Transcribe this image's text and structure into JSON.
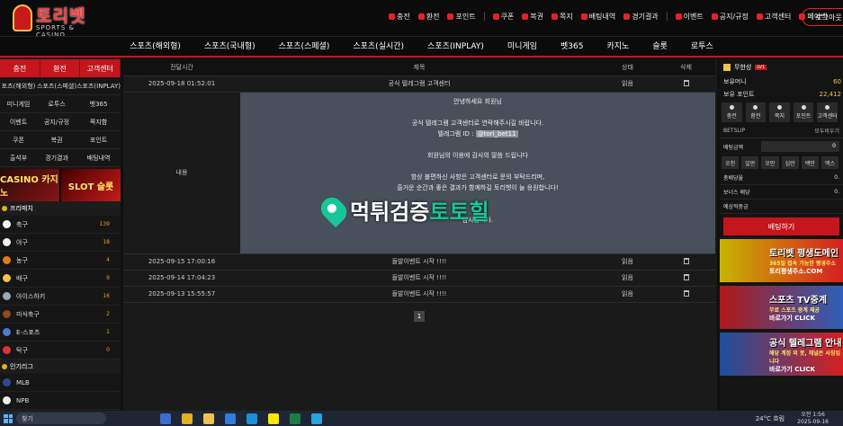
{
  "site": {
    "logo_text": "토리벳",
    "logo_sub": "SPORTS & CASINO"
  },
  "top_nav": [
    "충전",
    "환전",
    "포인트",
    "쿠폰",
    "복권",
    "쪽지",
    "배팅내역",
    "경기결과",
    "이벤트",
    "공지/규정",
    "고객센터",
    "페이백"
  ],
  "logout_label": "로그아웃",
  "main_nav": [
    "스포츠(해외형)",
    "스포츠(국내형)",
    "스포츠(스페셜)",
    "스포츠(실시간)",
    "스포츠(INPLAY)",
    "미니게임",
    "벳365",
    "카지노",
    "슬롯",
    "로투스"
  ],
  "left": {
    "buttons": [
      "충전",
      "환전",
      "고객센터"
    ],
    "grid": [
      "포츠(해외형)",
      "스포츠(스페셜)",
      "스포츠(INPLAY)",
      "미니게임",
      "로투스",
      "벳365",
      "이벤트",
      "공지/규정",
      "쪽지함",
      "쿠폰",
      "복권",
      "포인트",
      "출석부",
      "경기결과",
      "배팅내역"
    ],
    "banner_casino": "CASINO 카지노",
    "banner_slot": "SLOT 슬롯",
    "section_prematch": "프리매치",
    "sports": [
      {
        "name": "축구",
        "count": "139",
        "color": "#ffffff"
      },
      {
        "name": "야구",
        "count": "18",
        "color": "#f0f0f0"
      },
      {
        "name": "농구",
        "count": "4",
        "color": "#e07b1c"
      },
      {
        "name": "배구",
        "count": "9",
        "color": "#f2c14e"
      },
      {
        "name": "아이스하키",
        "count": "16",
        "color": "#9aa7b5"
      },
      {
        "name": "미식축구",
        "count": "2",
        "color": "#8a4a22"
      },
      {
        "name": "E-스포츠",
        "count": "1",
        "color": "#4a7bd0"
      },
      {
        "name": "탁구",
        "count": "0",
        "color": "#d33"
      }
    ],
    "section_popular": "인기리그",
    "league": "MLB",
    "league2": "NPB"
  },
  "table": {
    "headers": [
      "전달시간",
      "제목",
      "상태",
      "삭제"
    ],
    "first_row": {
      "time": "2025-09-18 01:52:01",
      "title": "공식 텔레그램 고객센터",
      "status": "읽음"
    },
    "detail_label": "내용",
    "message": [
      "안녕하세요 회원님",
      "",
      "공식 텔레그램 고객센터로 연락해주시길 바랍니다.",
      "텔레그램 ID : ",
      "",
      "회원님의 이용에 감사의 말씀 드립니다",
      "",
      "항상 불편하신 사항은 고객센터로 문의 부탁드리며,",
      "즐거운 순간과 좋은 결과가 함께하길 토리벳이 늘 응원합니다!",
      "",
      "",
      "감사합니다."
    ],
    "telegram_id": "@tori_bet11",
    "rows": [
      {
        "time": "2025-09-15 17:00:16",
        "title": "돌발이벤트 시작 !!!!",
        "status": "읽음"
      },
      {
        "time": "2025-09-14 17:04:23",
        "title": "돌발이벤트 시작 !!!!",
        "status": "읽음"
      },
      {
        "time": "2025-09-13 15:55:57",
        "title": "돌발이벤트 시작 !!!!",
        "status": "읽음"
      }
    ],
    "page": "1"
  },
  "watermark": {
    "part1": "먹튀검증",
    "part2": "토토힐"
  },
  "right": {
    "user": "무한성",
    "level": "LV1",
    "money_label": "보유머니",
    "money": "60",
    "point_label": "보유 포인트",
    "point": "22,412",
    "quick": [
      "충전",
      "환전",
      "쪽지",
      "포인트",
      "고객센터"
    ],
    "betslip": "BETSLIP",
    "clear_all": "모두비우기",
    "bet_amount_label": "배팅금액",
    "bet_amount": "0",
    "chips": [
      "오천",
      "일만",
      "오만",
      "십만",
      "백만",
      "맥스"
    ],
    "total_odds_label": "총배당율",
    "total_odds": "0.",
    "bonus_label": "보너스 배당",
    "bonus": "0.",
    "expected_label": "예상적중금",
    "expected": "",
    "bet_button": "배팅하기",
    "ads": [
      {
        "title": "토리벳 평생도메인",
        "sub": "365일 접속 가능한 평생주소",
        "line": "토리평생주소.COM"
      },
      {
        "title": "스포츠 TV중계",
        "sub": "무료 스포츠 중계 제공",
        "line": "바로가기 CLICK"
      },
      {
        "title": "공식 텔레그램 안내",
        "sub": "해당 계정 외 봇, 채널은 사칭입니다",
        "line": "바로가기 CLICK"
      }
    ]
  },
  "taskbar": {
    "search": "찾기",
    "weather": "24°C 흐림",
    "time": "오전 1:56",
    "date": "2025-09-16"
  }
}
